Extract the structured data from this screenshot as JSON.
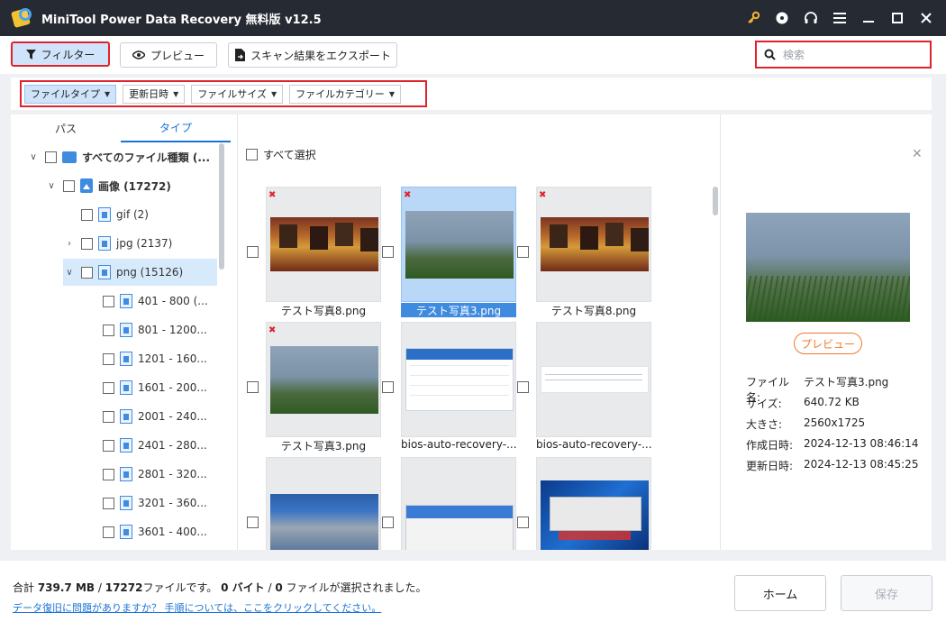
{
  "app": {
    "title": "MiniTool Power Data Recovery 無料版 v12.5"
  },
  "titlebar_icons": [
    "key-icon",
    "disc-icon",
    "headphones-icon",
    "menu-icon",
    "minimize-icon",
    "maximize-icon",
    "close-icon"
  ],
  "toolbar": {
    "filter_label": "フィルター",
    "preview_label": "プレビュー",
    "export_label": "スキャン結果をエクスポート",
    "search_placeholder": "検索"
  },
  "filters": {
    "file_type": "ファイルタイプ",
    "modified_date": "更新日時",
    "file_size": "ファイルサイズ",
    "file_category": "ファイルカテゴリー"
  },
  "tabs": {
    "path": "パス",
    "type": "タイプ"
  },
  "tree": {
    "all": "すべてのファイル種類 (...",
    "images": "画像 (17272)",
    "gif": "gif (2)",
    "jpg": "jpg (2137)",
    "png": "png (15126)",
    "ranges": [
      "401 - 800 (...",
      "801 - 1200...",
      "1201 - 160...",
      "1601 - 200...",
      "2001 - 240...",
      "2401 - 280...",
      "2801 - 320...",
      "3201 - 360...",
      "3601 - 400..."
    ]
  },
  "grid": {
    "select_all": "すべて選択",
    "files": [
      "テスト写真8.png",
      "テスト写真3.png",
      "テスト写真8.png",
      "テスト写真3.png",
      "bios-auto-recovery-...",
      "bios-auto-recovery-..."
    ]
  },
  "preview_panel": {
    "preview_button": "プレビュー",
    "labels": {
      "name": "ファイル名:",
      "size": "サイズ:",
      "dimensions": "大きさ:",
      "created": "作成日時:",
      "modified": "更新日時:"
    },
    "values": {
      "name": "テスト写真3.png",
      "size": "640.72 KB",
      "dimensions": "2560x1725",
      "created": "2024-12-13 08:46:14",
      "modified": "2024-12-13 08:45:25"
    }
  },
  "footer": {
    "summary_prefix": "合計 ",
    "total_size": "739.7 MB",
    "sep1": " / ",
    "total_files": "17272",
    "summary_mid": "ファイルです。 ",
    "selected_size": "0 バイト",
    "sep2": " / ",
    "selected_files": "0",
    "summary_end": " ファイルが選択されました。",
    "help_link": "データ復旧に問題がありますか？ 手順については、ここをクリックしてください。",
    "home_button": "ホーム",
    "save_button": "保存"
  },
  "colors": {
    "accent": "#1a74d6",
    "highlight_border": "#e0232b",
    "titlebar": "#262a33",
    "preview_button": "#f07a2c"
  }
}
